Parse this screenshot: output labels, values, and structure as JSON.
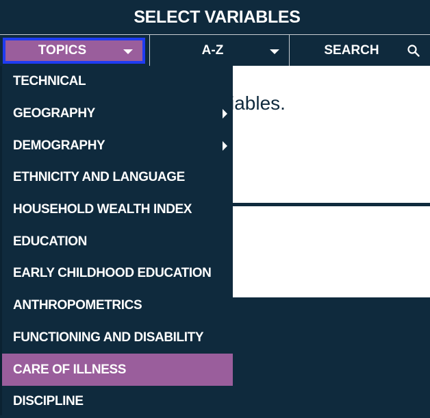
{
  "header": {
    "title": "SELECT VARIABLES"
  },
  "tabs": [
    {
      "label": "TOPICS",
      "icon": "caret-down-icon",
      "active": true
    },
    {
      "label": "A-Z",
      "icon": "caret-down-icon",
      "active": false
    },
    {
      "label": "SEARCH",
      "icon": "search-icon",
      "active": false
    }
  ],
  "content": {
    "text_fragment": "iables."
  },
  "menu": {
    "items": [
      {
        "label": "TECHNICAL",
        "submenu": false
      },
      {
        "label": "GEOGRAPHY",
        "submenu": true
      },
      {
        "label": "DEMOGRAPHY",
        "submenu": true
      },
      {
        "label": "ETHNICITY AND LANGUAGE",
        "submenu": false
      },
      {
        "label": "HOUSEHOLD WEALTH INDEX",
        "submenu": false
      },
      {
        "label": "EDUCATION",
        "submenu": false
      },
      {
        "label": "EARLY CHILDHOOD EDUCATION",
        "submenu": false
      },
      {
        "label": "ANTHROPOMETRICS",
        "submenu": false
      },
      {
        "label": "FUNCTIONING AND DISABILITY",
        "submenu": false
      },
      {
        "label": "CARE OF ILLNESS",
        "submenu": false,
        "highlighted": true
      },
      {
        "label": "DISCIPLINE",
        "submenu": false
      }
    ]
  },
  "colors": {
    "navy": "#0f2a3d",
    "accent_purple": "#9a5e9c",
    "focus_blue": "#1f3cf2",
    "panel_white": "#ffffff"
  }
}
